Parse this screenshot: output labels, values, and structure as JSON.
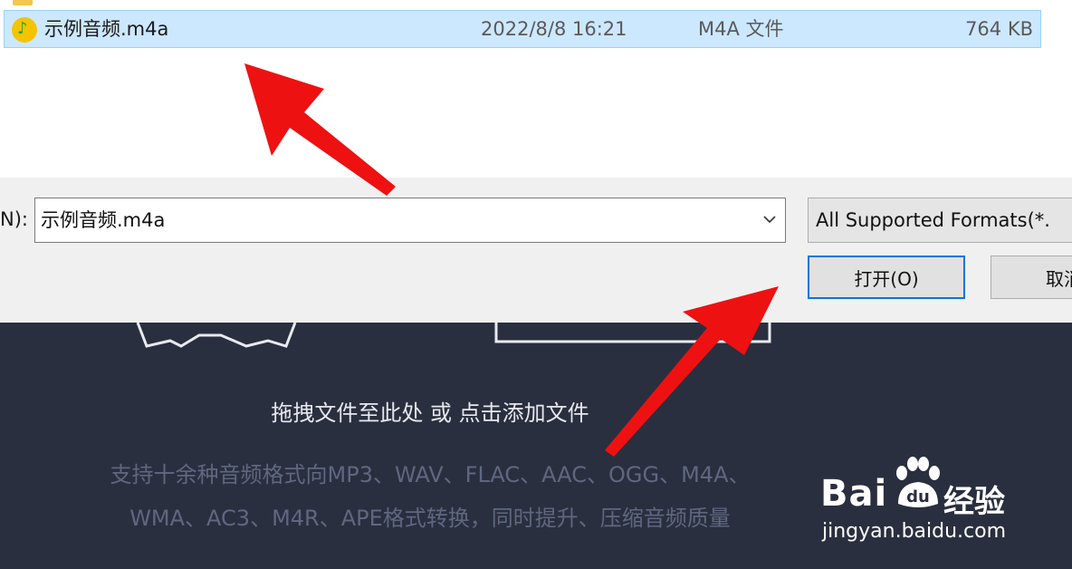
{
  "file_list": {
    "selected_file": {
      "name": "示例音频.m4a",
      "modified": "2022/8/8 16:21",
      "type": "M4A 文件",
      "size": "764 KB"
    }
  },
  "dialog": {
    "filename_label": "N):",
    "filename_value": "示例音频.m4a",
    "filetype_value": "All Supported Formats(*.",
    "open_label": "打开(O)",
    "cancel_label": "取消"
  },
  "app": {
    "drop_hint": "拖拽文件至此处 或 点击添加文件",
    "support_line1": "支持十余种音频格式向MP3、WAV、FLAC、AAC、OGG、M4A、",
    "support_line2": "WMA、AC3、M4R、APE格式转换，同时提升、压缩音频质量"
  },
  "watermark": {
    "logo": "Bai",
    "logo_du": "du",
    "cn": "经验",
    "url": "jingyan.baidu.com"
  },
  "colors": {
    "selection": "#cce8ff",
    "focus_border": "#0078d7",
    "app_bg": "#2a2f3f",
    "arrow": "#ee1111"
  }
}
